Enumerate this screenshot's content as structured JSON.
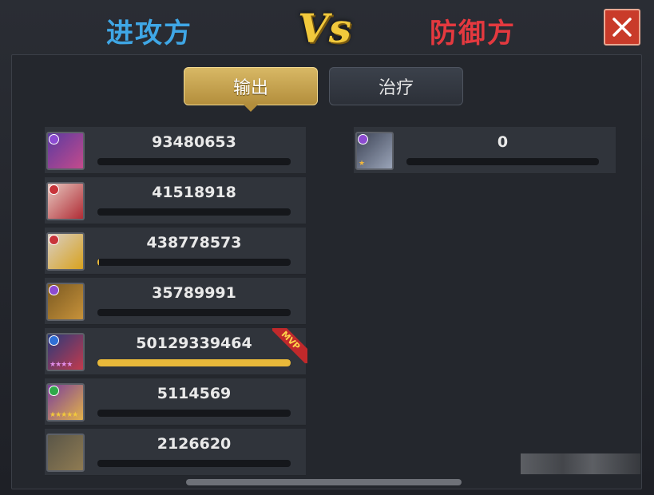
{
  "header": {
    "attacker_label": "进攻方",
    "vs_label": "Vs",
    "defender_label": "防御方",
    "close_icon": "close-icon"
  },
  "tabs": {
    "damage_label": "输出",
    "heal_label": "治疗",
    "active": "damage"
  },
  "attacker_rows": [
    {
      "value": "93480653",
      "progress": 0.0,
      "badge_color": "#8c4bd1",
      "mvp": false
    },
    {
      "value": "41518918",
      "progress": 0.0,
      "badge_color": "#c8343a",
      "mvp": false
    },
    {
      "value": "438778573",
      "progress": 0.01,
      "badge_color": "#c8343a",
      "mvp": false
    },
    {
      "value": "35789991",
      "progress": 0.0,
      "badge_color": "#8c4bd1",
      "mvp": false
    },
    {
      "value": "50129339464",
      "progress": 1.0,
      "badge_color": "#2f6fd6",
      "mvp": true,
      "mvp_label": "MVP",
      "stars": "★★★★"
    },
    {
      "value": "5114569",
      "progress": 0.0,
      "badge_color": "#2fa84a",
      "mvp": false,
      "stars": "★★★★★"
    },
    {
      "value": "2126620",
      "progress": 0.0,
      "badge_color": "",
      "mvp": false
    }
  ],
  "defender_rows": [
    {
      "value": "0",
      "progress": 0.0,
      "badge_color": "#8c4bd1",
      "stars": "★"
    }
  ],
  "colors": {
    "attacker": "#3fa7e6",
    "defender": "#e4393f",
    "accent_gold": "#e9b93a",
    "close": "#c93b2a"
  }
}
